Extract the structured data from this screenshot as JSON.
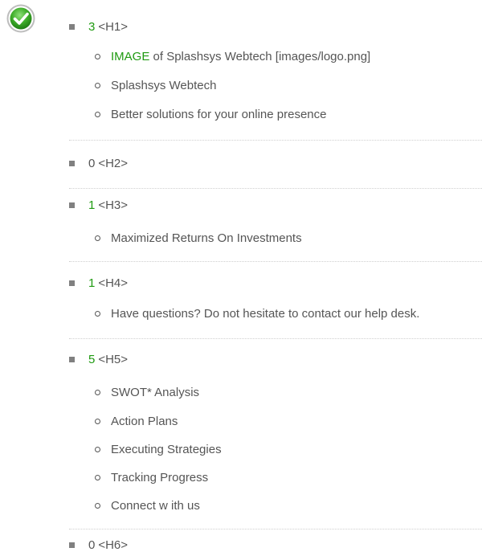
{
  "status_icon": "check-circle-icon",
  "colors": {
    "accent_green": "#1f9a11",
    "text": "#555555",
    "bullet": "#808080",
    "divider": "#cfcfcf"
  },
  "headings": [
    {
      "count": "3",
      "tag": "<H1>",
      "items": [
        {
          "prefix": "IMAGE",
          "text": " of Splashsys Webtech [images/logo.png]"
        },
        {
          "prefix": "",
          "text": "Splashsys Webtech"
        },
        {
          "prefix": "",
          "text": "Better solutions for your online presence"
        }
      ]
    },
    {
      "count": "0",
      "tag": "<H2>",
      "items": []
    },
    {
      "count": "1",
      "tag": "<H3>",
      "items": [
        {
          "prefix": "",
          "text": "Maximized Returns On Investments"
        }
      ]
    },
    {
      "count": "1",
      "tag": "<H4>",
      "items": [
        {
          "prefix": "",
          "text": "Have questions? Do not hesitate to contact our help desk."
        }
      ]
    },
    {
      "count": "5",
      "tag": "<H5>",
      "items": [
        {
          "prefix": "",
          "text": "SWOT* Analysis"
        },
        {
          "prefix": "",
          "text": "Action Plans"
        },
        {
          "prefix": "",
          "text": "Executing Strategies"
        },
        {
          "prefix": "",
          "text": "Tracking Progress"
        },
        {
          "prefix": "",
          "text": "Connect w ith us"
        }
      ]
    },
    {
      "count": "0",
      "tag": "<H6>",
      "items": []
    }
  ]
}
